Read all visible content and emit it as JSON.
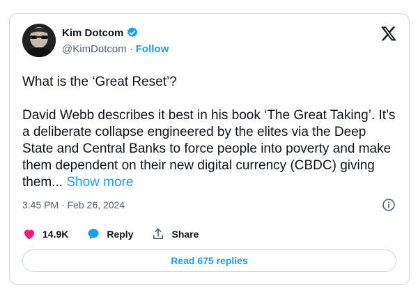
{
  "author": {
    "name": "Kim Dotcom",
    "handle": "@KimDotcom",
    "follow_label": "Follow",
    "separator": "·"
  },
  "tweet": {
    "question": "What is the ‘Great Reset’?",
    "body": "David Webb describes it best in his book ‘The Great Taking’. It’s a deliberate collapse engineered by the elites via the Deep State and Central Banks to force people into poverty and make them dependent on their new digital currency (CBDC) giving them...",
    "show_more_label": "Show more",
    "timestamp": "3:45 PM · Feb 26, 2024"
  },
  "actions": {
    "likes": "14.9K",
    "reply_label": "Reply",
    "share_label": "Share"
  },
  "read_replies_label": "Read 675 replies",
  "colors": {
    "accent": "#1d9bf0",
    "like": "#f91880",
    "muted": "#536471"
  },
  "icons": [
    "verified-badge-icon",
    "x-logo-icon",
    "info-icon",
    "heart-icon",
    "reply-bubble-icon",
    "share-icon"
  ]
}
